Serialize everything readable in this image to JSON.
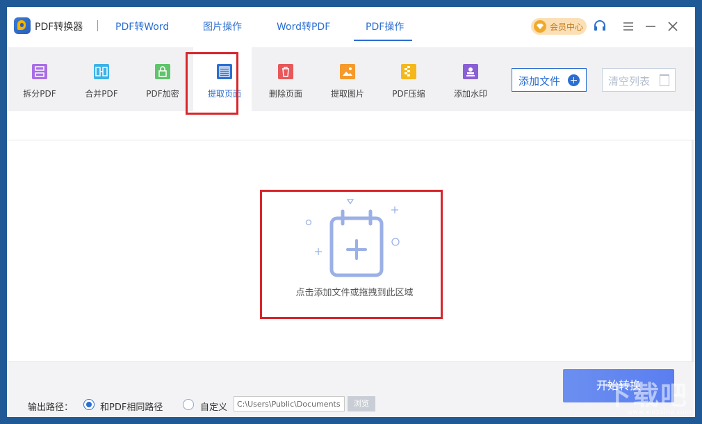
{
  "app": {
    "title": "PDF转换器"
  },
  "nav": {
    "tabs": [
      {
        "label": "PDF转Word"
      },
      {
        "label": "图片操作"
      },
      {
        "label": "Word转PDF"
      },
      {
        "label": "PDF操作"
      }
    ],
    "active_tab": "PDF操作"
  },
  "header_actions": {
    "vip_label": "会员中心",
    "icons": [
      "headset-icon",
      "menu-icon",
      "minimize-icon",
      "close-icon"
    ]
  },
  "toolbar": {
    "tools": [
      {
        "label": "拆分PDF",
        "icon": "split-pdf-icon",
        "color": "#a86ee6"
      },
      {
        "label": "合并PDF",
        "icon": "merge-pdf-icon",
        "color": "#3bb3e8"
      },
      {
        "label": "PDF加密",
        "icon": "lock-icon",
        "color": "#5fc46a"
      },
      {
        "label": "提取页面",
        "icon": "extract-page-icon",
        "color": "#2c6fd1"
      },
      {
        "label": "删除页面",
        "icon": "delete-page-icon",
        "color": "#e8585a"
      },
      {
        "label": "提取图片",
        "icon": "extract-image-icon",
        "color": "#f59a2b"
      },
      {
        "label": "PDF压缩",
        "icon": "compress-icon",
        "color": "#f5b81c"
      },
      {
        "label": "添加水印",
        "icon": "watermark-icon",
        "color": "#8a5fd6"
      }
    ],
    "active_tool": "提取页面",
    "add_file_label": "添加文件",
    "clear_list_label": "清空列表"
  },
  "dropzone": {
    "hint": "点击添加文件或拖拽到此区域",
    "icon": "add-file-calendar-icon"
  },
  "footer": {
    "output_label": "输出路径：",
    "option_same": "和PDF相同路径",
    "option_custom": "自定义",
    "selected_option": "和PDF相同路径",
    "path_value": "C:\\Users\\Public\\Documents",
    "browse_label": "浏览",
    "start_label": "开始转换"
  },
  "colors": {
    "accent": "#2c6fd1",
    "highlight_box": "#d8262a",
    "start_button": "#5a7ef0"
  }
}
